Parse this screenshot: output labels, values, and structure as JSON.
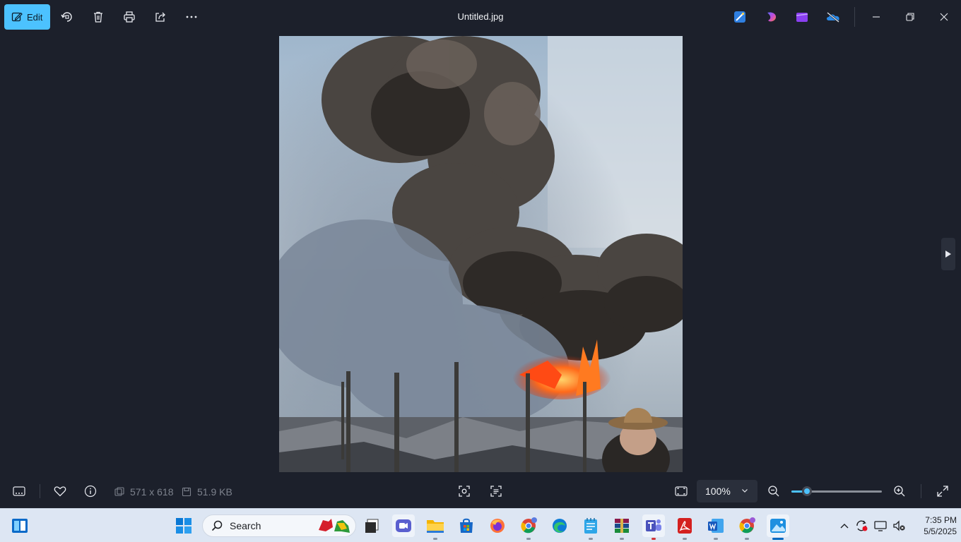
{
  "toolbar": {
    "edit_label": "Edit",
    "icons": [
      "rotate-icon",
      "delete-icon",
      "print-icon",
      "share-icon",
      "more-icon"
    ]
  },
  "window": {
    "title": "Untitled.jpg",
    "app_icons": [
      "designer-icon",
      "clipchamp-gradient-icon",
      "clipchamp-icon",
      "onedrive-offline-icon"
    ]
  },
  "image": {
    "description_alt": ""
  },
  "bottom": {
    "dimensions": "571 x 618",
    "file_size": "51.9 KB",
    "zoom_label": "100%",
    "zoom_level": 0.17
  },
  "taskbar": {
    "search_placeholder": "Search",
    "apps": [
      "start",
      "file-explorer",
      "meet",
      "files",
      "store",
      "firefox",
      "chrome-r",
      "edge",
      "notepad",
      "winrar",
      "teams",
      "acrobat",
      "word",
      "chrome-w",
      "photos"
    ]
  },
  "tray": {
    "time": "7:35 PM",
    "date": "5/5/2025"
  },
  "colors": {
    "accent": "#4cc2ff",
    "background": "#1c202b",
    "taskbar": "#dde6f3"
  }
}
